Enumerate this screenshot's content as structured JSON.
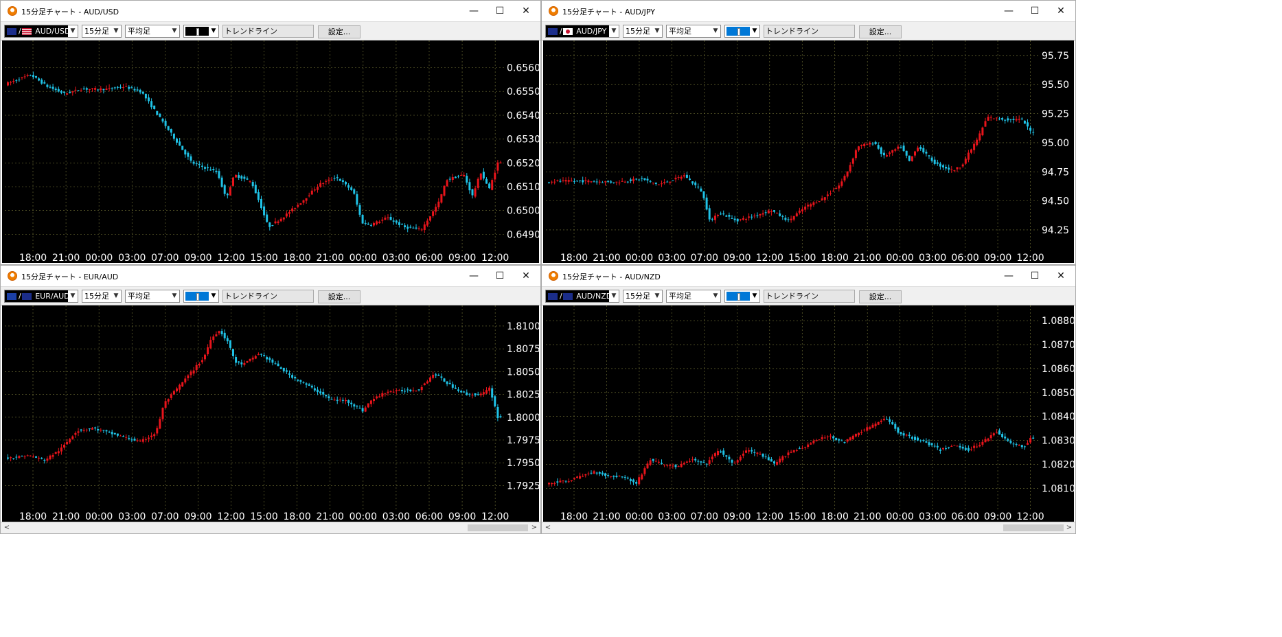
{
  "toolbar_labels": {
    "setting": "設定..."
  },
  "window_buttons": {
    "minimize": "—",
    "maximize": "☐",
    "close": "✕"
  },
  "scroll_arrows": {
    "left": "<",
    "right": ">"
  },
  "colors": {
    "up": "#e8141b",
    "down": "#1fc2e6",
    "grid": "#7a7a3a",
    "background": "#000000",
    "axis_text": "#ffffff",
    "swatch_black": "#000000",
    "swatch_blue": "#0078d7"
  },
  "windows": [
    {
      "title": "15分足チャート - AUD/USD",
      "pair": "AUD/USD",
      "flags": [
        "au",
        "us"
      ],
      "timeframe": "15分足",
      "chart_style": "平均足",
      "trendline": "トレンドライン",
      "swatch": "swatch_black"
    },
    {
      "title": "15分足チャート - AUD/JPY",
      "pair": "AUD/JPY",
      "flags": [
        "au",
        "jp"
      ],
      "timeframe": "15分足",
      "chart_style": "平均足",
      "trendline": "トレンドライン",
      "swatch": "swatch_blue"
    },
    {
      "title": "15分足チャート - EUR/AUD",
      "pair": "EUR/AUD",
      "flags": [
        "eu",
        "au"
      ],
      "timeframe": "15分足",
      "chart_style": "平均足",
      "trendline": "トレンドライン",
      "swatch": "swatch_blue"
    },
    {
      "title": "15分足チャート - AUD/NZD",
      "pair": "AUD/NZD",
      "flags": [
        "au",
        "nz"
      ],
      "timeframe": "15分足",
      "chart_style": "平均足",
      "trendline": "トレンドライン",
      "swatch": "swatch_blue"
    }
  ],
  "chart_data": [
    {
      "type": "candlestick",
      "title": "AUD/USD",
      "x_ticks": [
        "18:00",
        "21:00",
        "00:00",
        "03:00",
        "07:00",
        "09:00",
        "12:00",
        "15:00",
        "18:00",
        "21:00",
        "00:00",
        "03:00",
        "06:00",
        "09:00",
        "12:00"
      ],
      "y_ticks": [
        "0.6560",
        "0.6550",
        "0.6540",
        "0.6530",
        "0.6520",
        "0.6510",
        "0.6500",
        "0.6490"
      ],
      "ylim": [
        0.64855,
        0.65685
      ],
      "path": [
        [
          0,
          0.6553
        ],
        [
          3,
          0.6557
        ],
        [
          5,
          0.6552
        ],
        [
          7,
          0.6549
        ],
        [
          9,
          0.6551
        ],
        [
          12,
          0.6551
        ],
        [
          14,
          0.6552
        ],
        [
          16,
          0.655
        ],
        [
          19,
          0.6535
        ],
        [
          22,
          0.652
        ],
        [
          25,
          0.6516
        ],
        [
          26,
          0.6505
        ],
        [
          27,
          0.6515
        ],
        [
          29,
          0.6512
        ],
        [
          30,
          0.6503
        ],
        [
          31,
          0.6493
        ],
        [
          33,
          0.6498
        ],
        [
          35,
          0.6504
        ],
        [
          37,
          0.6511
        ],
        [
          39,
          0.6514
        ],
        [
          41,
          0.6508
        ],
        [
          42,
          0.6495
        ],
        [
          43,
          0.6494
        ],
        [
          45,
          0.6497
        ],
        [
          47,
          0.6493
        ],
        [
          49,
          0.6492
        ],
        [
          51,
          0.6503
        ],
        [
          52,
          0.6513
        ],
        [
          54,
          0.6515
        ],
        [
          55,
          0.6506
        ],
        [
          56,
          0.6516
        ],
        [
          57,
          0.6509
        ],
        [
          58,
          0.652
        ]
      ],
      "grid": true
    },
    {
      "type": "candlestick",
      "title": "AUD/JPY",
      "x_ticks": [
        "18:00",
        "21:00",
        "00:00",
        "03:00",
        "07:00",
        "09:00",
        "12:00",
        "15:00",
        "18:00",
        "21:00",
        "00:00",
        "03:00",
        "06:00",
        "09:00",
        "12:00"
      ],
      "y_ticks": [
        "95.75",
        "95.50",
        "95.25",
        "95.00",
        "94.75",
        "94.50",
        "94.25"
      ],
      "ylim": [
        94.12,
        95.82
      ],
      "path": [
        [
          0,
          94.67
        ],
        [
          5,
          94.67
        ],
        [
          8,
          94.66
        ],
        [
          11,
          94.69
        ],
        [
          13,
          94.64
        ],
        [
          15,
          94.69
        ],
        [
          16,
          94.72
        ],
        [
          18,
          94.58
        ],
        [
          19,
          94.32
        ],
        [
          20,
          94.4
        ],
        [
          22,
          94.33
        ],
        [
          24,
          94.37
        ],
        [
          26,
          94.42
        ],
        [
          28,
          94.33
        ],
        [
          30,
          94.45
        ],
        [
          32,
          94.52
        ],
        [
          34,
          94.64
        ],
        [
          35,
          94.78
        ],
        [
          36,
          94.97
        ],
        [
          38,
          95.0
        ],
        [
          39,
          94.88
        ],
        [
          41,
          94.97
        ],
        [
          42,
          94.84
        ],
        [
          43,
          94.97
        ],
        [
          45,
          94.82
        ],
        [
          47,
          94.76
        ],
        [
          48,
          94.8
        ],
        [
          50,
          95.05
        ],
        [
          51,
          95.22
        ],
        [
          53,
          95.2
        ],
        [
          55,
          95.2
        ],
        [
          56,
          95.1
        ]
      ],
      "grid": true
    },
    {
      "type": "candlestick",
      "title": "EUR/AUD",
      "x_ticks": [
        "18:00",
        "21:00",
        "00:00",
        "03:00",
        "07:00",
        "09:00",
        "12:00",
        "15:00",
        "18:00",
        "21:00",
        "00:00",
        "03:00",
        "06:00",
        "09:00",
        "12:00"
      ],
      "y_ticks": [
        "1.8100",
        "1.8075",
        "1.8050",
        "1.8025",
        "1.8000",
        "1.7975",
        "1.7950",
        "1.7925"
      ],
      "ylim": [
        1.7905,
        1.8115
      ],
      "path": [
        [
          0,
          1.7955
        ],
        [
          3,
          1.7958
        ],
        [
          5,
          1.7953
        ],
        [
          7,
          1.7965
        ],
        [
          9,
          1.7985
        ],
        [
          11,
          1.7988
        ],
        [
          13,
          1.7983
        ],
        [
          15,
          1.7978
        ],
        [
          17,
          1.7973
        ],
        [
          19,
          1.7983
        ],
        [
          20,
          1.8015
        ],
        [
          21,
          1.8025
        ],
        [
          23,
          1.8045
        ],
        [
          25,
          1.8065
        ],
        [
          26,
          1.8088
        ],
        [
          27,
          1.8095
        ],
        [
          28,
          1.8083
        ],
        [
          29,
          1.806
        ],
        [
          30,
          1.8058
        ],
        [
          32,
          1.807
        ],
        [
          34,
          1.8058
        ],
        [
          36,
          1.8045
        ],
        [
          38,
          1.8035
        ],
        [
          40,
          1.8025
        ],
        [
          41,
          1.8019
        ],
        [
          43,
          1.8018
        ],
        [
          45,
          1.8007
        ],
        [
          46,
          1.8018
        ],
        [
          48,
          1.8028
        ],
        [
          50,
          1.8029
        ],
        [
          52,
          1.803
        ],
        [
          54,
          1.8048
        ],
        [
          56,
          1.8035
        ],
        [
          58,
          1.8025
        ],
        [
          60,
          1.8025
        ],
        [
          61,
          1.8032
        ],
        [
          62,
          1.8
        ]
      ],
      "grid": true
    },
    {
      "type": "candlestick",
      "title": "AUD/NZD",
      "x_ticks": [
        "18:00",
        "21:00",
        "00:00",
        "03:00",
        "07:00",
        "09:00",
        "12:00",
        "15:00",
        "18:00",
        "21:00",
        "00:00",
        "03:00",
        "06:00",
        "09:00",
        "12:00"
      ],
      "y_ticks": [
        "1.0880",
        "1.0870",
        "1.0860",
        "1.0850",
        "1.0840",
        "1.0830",
        "1.0820",
        "1.0810"
      ],
      "ylim": [
        1.08035,
        1.08835
      ],
      "path": [
        [
          0,
          1.0812
        ],
        [
          3,
          1.0813
        ],
        [
          5,
          1.0815
        ],
        [
          7,
          1.0817
        ],
        [
          9,
          1.0815
        ],
        [
          11,
          1.0815
        ],
        [
          13,
          1.0812
        ],
        [
          15,
          1.0822
        ],
        [
          17,
          1.082
        ],
        [
          19,
          1.0819
        ],
        [
          21,
          1.0822
        ],
        [
          23,
          1.082
        ],
        [
          25,
          1.0826
        ],
        [
          27,
          1.082
        ],
        [
          29,
          1.0826
        ],
        [
          31,
          1.0824
        ],
        [
          33,
          1.082
        ],
        [
          35,
          1.0825
        ],
        [
          37,
          1.0827
        ],
        [
          39,
          1.083
        ],
        [
          41,
          1.0832
        ],
        [
          43,
          1.0829
        ],
        [
          45,
          1.0833
        ],
        [
          47,
          1.0836
        ],
        [
          49,
          1.0839
        ],
        [
          50,
          1.0837
        ],
        [
          51,
          1.0833
        ],
        [
          53,
          1.0831
        ],
        [
          55,
          1.0829
        ],
        [
          57,
          1.0826
        ],
        [
          59,
          1.0828
        ],
        [
          61,
          1.0826
        ],
        [
          63,
          1.0829
        ],
        [
          65,
          1.0834
        ],
        [
          67,
          1.0829
        ],
        [
          69,
          1.0827
        ],
        [
          70,
          1.0831
        ]
      ],
      "grid": true
    }
  ]
}
